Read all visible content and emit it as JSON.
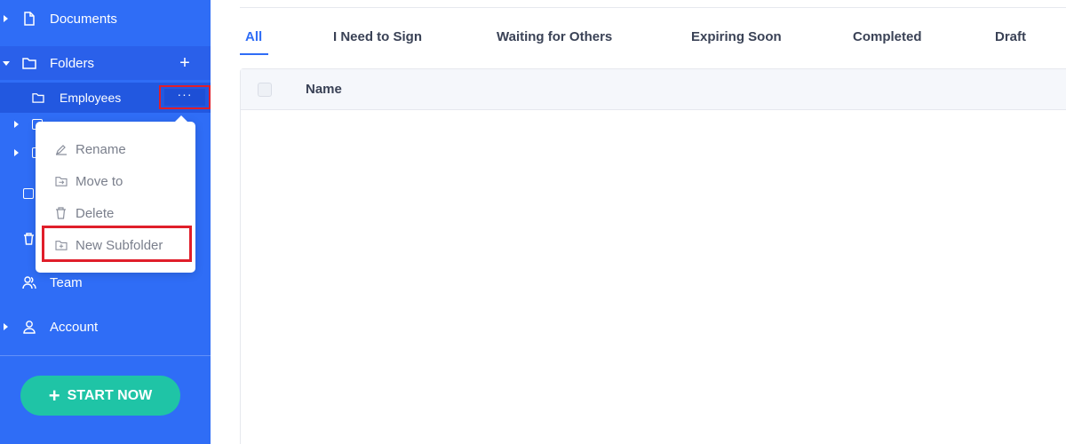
{
  "sidebar": {
    "items": [
      {
        "label": "Documents",
        "icon": "document-icon"
      },
      {
        "label": "Folders",
        "icon": "folder-icon"
      },
      {
        "label": "Team",
        "icon": "team-icon"
      },
      {
        "label": "Account",
        "icon": "account-icon"
      }
    ],
    "subfolder": {
      "label": "Employees",
      "icon": "folder-icon",
      "more_label": "···"
    },
    "start_button": {
      "label": "START NOW",
      "plus": "+"
    },
    "add_folder": "+",
    "colors": {
      "sidebar_bg": "#2f6df6",
      "start_btn": "#1fc4a6",
      "highlight": "#e01e2a"
    }
  },
  "context_menu": {
    "items": [
      {
        "label": "Rename",
        "icon": "pencil-icon"
      },
      {
        "label": "Move to",
        "icon": "folder-move-icon"
      },
      {
        "label": "Delete",
        "icon": "trash-icon"
      },
      {
        "label": "New Subfolder",
        "icon": "folder-plus-icon"
      }
    ]
  },
  "tabs": [
    {
      "label": "All"
    },
    {
      "label": "I Need to Sign"
    },
    {
      "label": "Waiting for Others"
    },
    {
      "label": "Expiring Soon"
    },
    {
      "label": "Completed"
    },
    {
      "label": "Draft"
    }
  ],
  "table": {
    "columns": [
      {
        "label": "Name"
      }
    ]
  }
}
